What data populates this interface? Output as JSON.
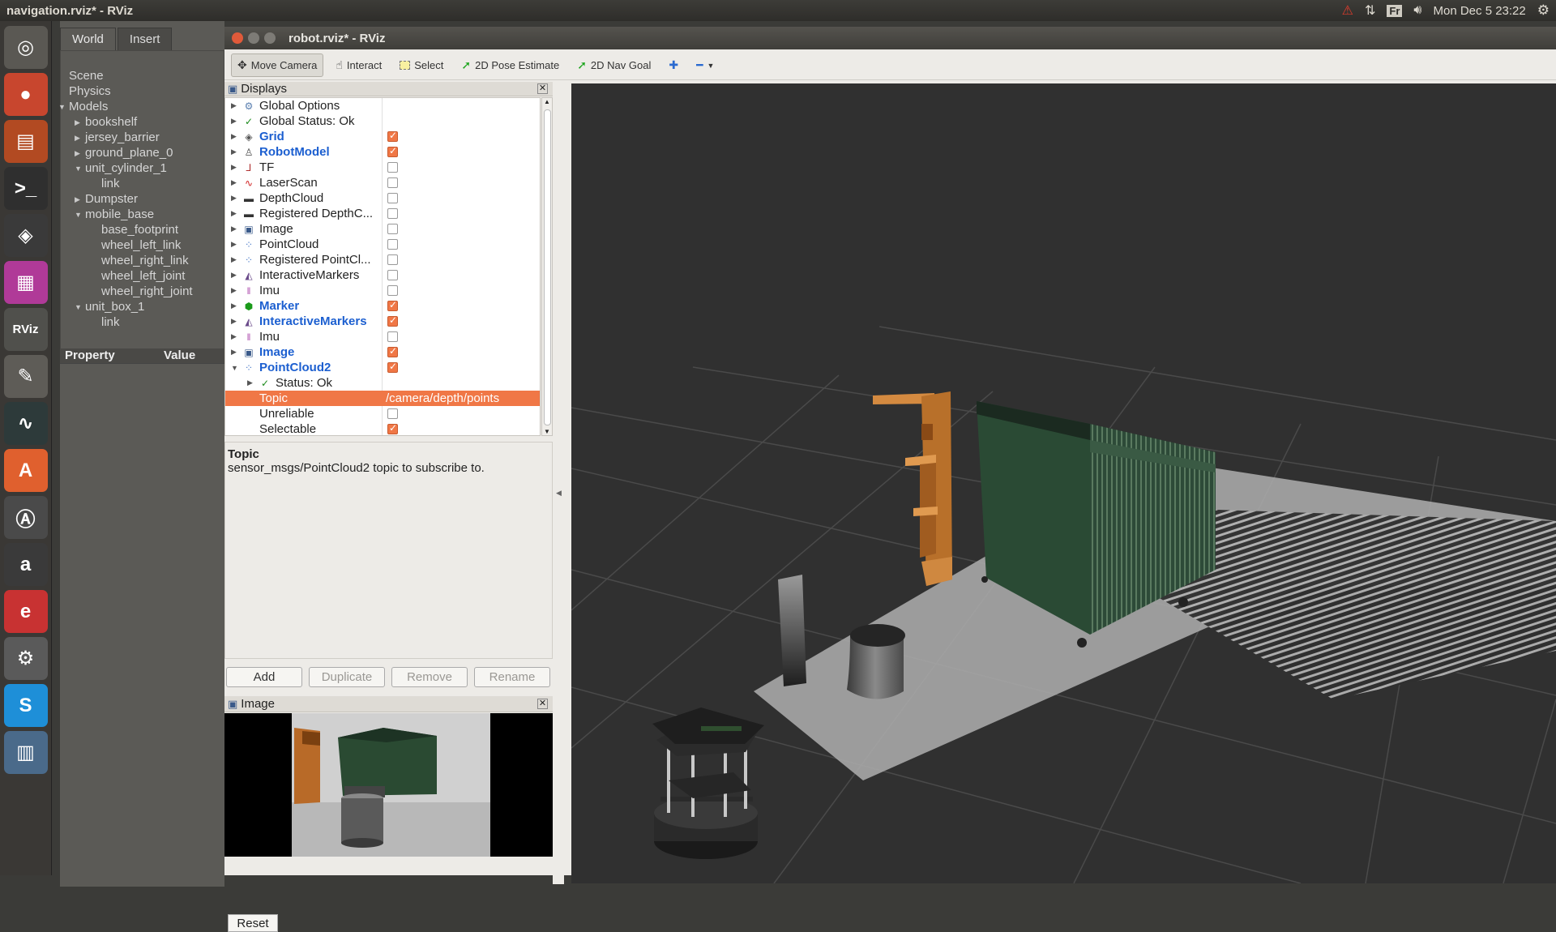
{
  "topbar": {
    "window_title": "navigation.rviz* - RViz",
    "lang": "Fr",
    "clock": "Mon Dec  5 23:22"
  },
  "launcher": {
    "items": [
      {
        "name": "ubuntu-logo-icon",
        "color": "#5a5853",
        "glyph": "◎"
      },
      {
        "name": "chrome-icon",
        "color": "#c8462e",
        "glyph": "●"
      },
      {
        "name": "files-icon",
        "color": "#b24a22",
        "glyph": "▤"
      },
      {
        "name": "terminal-icon",
        "color": "#2f2f2f",
        "glyph": ">_"
      },
      {
        "name": "sublime-icon",
        "color": "#3a3a3a",
        "glyph": "◈"
      },
      {
        "name": "workspace-icon",
        "color": "#b03a98",
        "glyph": "▦"
      },
      {
        "name": "rviz-icon",
        "color": "#50504c",
        "glyph": "RViz"
      },
      {
        "name": "text-editor-icon",
        "color": "#5e5c57",
        "glyph": "✎"
      },
      {
        "name": "system-monitor-icon",
        "color": "#2d3a3a",
        "glyph": "∿"
      },
      {
        "name": "software-center-icon",
        "color": "#e0602e",
        "glyph": "A"
      },
      {
        "name": "updater-icon",
        "color": "#4a4a4a",
        "glyph": "Ⓐ"
      },
      {
        "name": "amazon-icon",
        "color": "#3a3a3a",
        "glyph": "a"
      },
      {
        "name": "app-red-icon",
        "color": "#c83232",
        "glyph": "e"
      },
      {
        "name": "settings-icon",
        "color": "#5a5a5a",
        "glyph": "⚙"
      },
      {
        "name": "skype-icon",
        "color": "#1e8fd8",
        "glyph": "S"
      },
      {
        "name": "stacked-apps-icon",
        "color": "#4a6a8a",
        "glyph": "▥"
      }
    ]
  },
  "gazebo": {
    "tabs": [
      "World",
      "Insert"
    ],
    "tree": [
      {
        "label": "Scene",
        "indent": 0,
        "arrow": ""
      },
      {
        "label": "Physics",
        "indent": 0,
        "arrow": ""
      },
      {
        "label": "Models",
        "indent": 0,
        "arrow": "▼"
      },
      {
        "label": "bookshelf",
        "indent": 1,
        "arrow": "▶"
      },
      {
        "label": "jersey_barrier",
        "indent": 1,
        "arrow": "▶"
      },
      {
        "label": "ground_plane_0",
        "indent": 1,
        "arrow": "▶"
      },
      {
        "label": "unit_cylinder_1",
        "indent": 1,
        "arrow": "▼"
      },
      {
        "label": "link",
        "indent": 2,
        "arrow": ""
      },
      {
        "label": "Dumpster",
        "indent": 1,
        "arrow": "▶"
      },
      {
        "label": "mobile_base",
        "indent": 1,
        "arrow": "▼"
      },
      {
        "label": "base_footprint",
        "indent": 2,
        "arrow": ""
      },
      {
        "label": "wheel_left_link",
        "indent": 2,
        "arrow": ""
      },
      {
        "label": "wheel_right_link",
        "indent": 2,
        "arrow": ""
      },
      {
        "label": "wheel_left_joint",
        "indent": 2,
        "arrow": ""
      },
      {
        "label": "wheel_right_joint",
        "indent": 2,
        "arrow": ""
      },
      {
        "label": "unit_box_1",
        "indent": 1,
        "arrow": "▼"
      },
      {
        "label": "link",
        "indent": 2,
        "arrow": ""
      }
    ],
    "property_header": "Property",
    "value_header": "Value"
  },
  "rviz": {
    "title": "robot.rviz* - RViz",
    "toolbar": {
      "move_camera": "Move Camera",
      "interact": "Interact",
      "select": "Select",
      "pose_estimate": "2D Pose Estimate",
      "nav_goal": "2D Nav Goal"
    },
    "displays_title": "Displays",
    "displays": [
      {
        "label": "Global Options",
        "icon": "⚙",
        "icon_color": "#5a7fb0",
        "arrow": "▶",
        "bold": false,
        "check": null,
        "indent": 0
      },
      {
        "label": "Global Status: Ok",
        "icon": "✓",
        "icon_color": "#1a8a1a",
        "arrow": "▶",
        "bold": false,
        "check": null,
        "indent": 0
      },
      {
        "label": "Grid",
        "icon": "◈",
        "icon_color": "#555",
        "arrow": "▶",
        "bold": true,
        "check": true,
        "indent": 0
      },
      {
        "label": "RobotModel",
        "icon": "♙",
        "icon_color": "#444",
        "arrow": "▶",
        "bold": true,
        "check": true,
        "indent": 0
      },
      {
        "label": "TF",
        "icon": "⅃",
        "icon_color": "#b03030",
        "arrow": "▶",
        "bold": false,
        "check": false,
        "indent": 0
      },
      {
        "label": "LaserScan",
        "icon": "∿",
        "icon_color": "#d02020",
        "arrow": "▶",
        "bold": false,
        "check": false,
        "indent": 0
      },
      {
        "label": "DepthCloud",
        "icon": "▬",
        "icon_color": "#333",
        "arrow": "▶",
        "bold": false,
        "check": false,
        "indent": 0
      },
      {
        "label": "Registered DepthC...",
        "icon": "▬",
        "icon_color": "#333",
        "arrow": "▶",
        "bold": false,
        "check": false,
        "indent": 0
      },
      {
        "label": "Image",
        "icon": "▣",
        "icon_color": "#3a5a8a",
        "arrow": "▶",
        "bold": false,
        "check": false,
        "indent": 0
      },
      {
        "label": "PointCloud",
        "icon": "⁘",
        "icon_color": "#4a7ac8",
        "arrow": "▶",
        "bold": false,
        "check": false,
        "indent": 0
      },
      {
        "label": "Registered PointCl...",
        "icon": "⁘",
        "icon_color": "#4a7ac8",
        "arrow": "▶",
        "bold": false,
        "check": false,
        "indent": 0
      },
      {
        "label": "InteractiveMarkers",
        "icon": "◭",
        "icon_color": "#6a4a8a",
        "arrow": "▶",
        "bold": false,
        "check": false,
        "indent": 0
      },
      {
        "label": "Imu",
        "icon": "‖",
        "icon_color": "#b050b0",
        "arrow": "▶",
        "bold": false,
        "check": false,
        "indent": 0
      },
      {
        "label": "Marker",
        "icon": "⬢",
        "icon_color": "#1a9a1a",
        "arrow": "▶",
        "bold": true,
        "check": true,
        "indent": 0
      },
      {
        "label": "InteractiveMarkers",
        "icon": "◭",
        "icon_color": "#6a4a8a",
        "arrow": "▶",
        "bold": true,
        "check": true,
        "indent": 0
      },
      {
        "label": "Imu",
        "icon": "‖",
        "icon_color": "#b050b0",
        "arrow": "▶",
        "bold": false,
        "check": false,
        "indent": 0
      },
      {
        "label": "Image",
        "icon": "▣",
        "icon_color": "#3a5a8a",
        "arrow": "▶",
        "bold": true,
        "check": true,
        "indent": 0
      },
      {
        "label": "PointCloud2",
        "icon": "⁘",
        "icon_color": "#4a7ac8",
        "arrow": "▼",
        "bold": true,
        "check": true,
        "indent": 0
      },
      {
        "label": "Status: Ok",
        "icon": "✓",
        "icon_color": "#1a8a1a",
        "arrow": "▶",
        "bold": false,
        "check": null,
        "indent": 1
      },
      {
        "label": "Topic",
        "icon": "",
        "icon_color": "",
        "arrow": "",
        "bold": false,
        "check": null,
        "indent": 1,
        "value": "/camera/depth/points",
        "selected": true
      },
      {
        "label": "Unreliable",
        "icon": "",
        "icon_color": "",
        "arrow": "",
        "bold": false,
        "check": false,
        "indent": 1
      },
      {
        "label": "Selectable",
        "icon": "",
        "icon_color": "",
        "arrow": "",
        "bold": false,
        "check": true,
        "indent": 1
      }
    ],
    "description": {
      "heading": "Topic",
      "text": "sensor_msgs/PointCloud2 topic to subscribe to."
    },
    "buttons": {
      "add": "Add",
      "duplicate": "Duplicate",
      "remove": "Remove",
      "rename": "Rename"
    },
    "image_title": "Image",
    "reset": "Reset"
  },
  "colors": {
    "accent": "#f07746",
    "link_blue": "#1c5fd0"
  }
}
